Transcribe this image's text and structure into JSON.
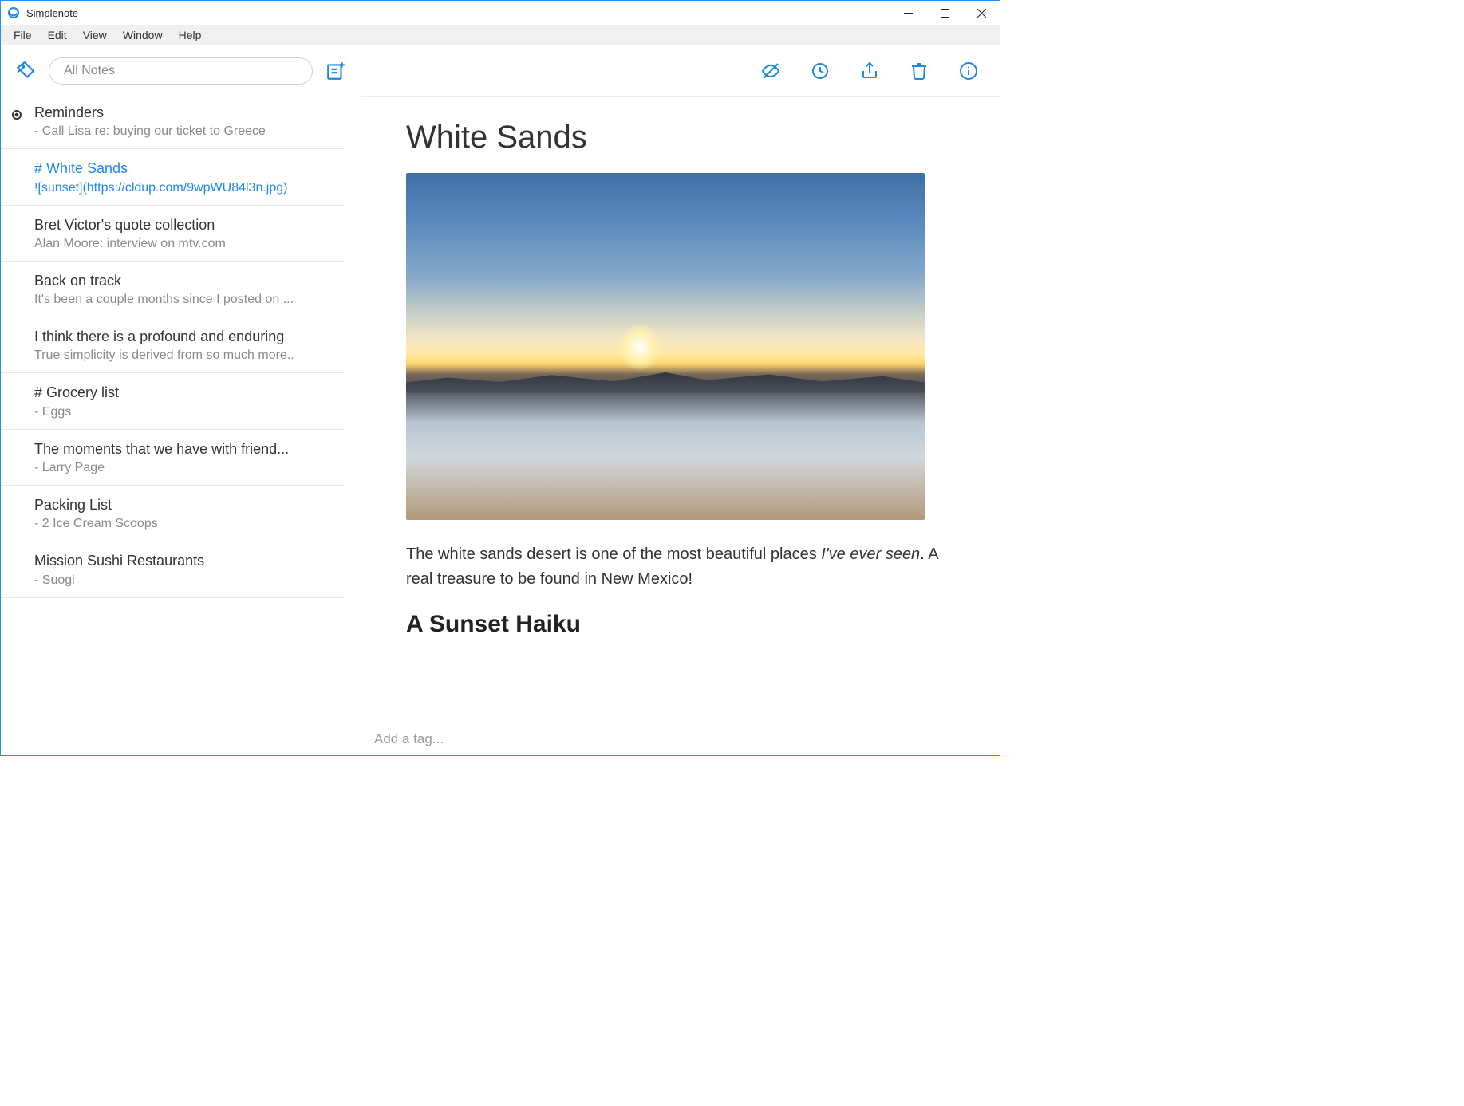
{
  "window": {
    "title": "Simplenote"
  },
  "menubar": {
    "items": [
      "File",
      "Edit",
      "View",
      "Window",
      "Help"
    ]
  },
  "sidebar": {
    "search_placeholder": "All Notes",
    "notes": [
      {
        "title": "Reminders",
        "preview": "- Call Lisa re: buying our ticket to Greece",
        "pinned": true,
        "selected": false
      },
      {
        "title": "# White Sands",
        "preview": "![sunset](https://cldup.com/9wpWU84l3n.jpg)",
        "pinned": false,
        "selected": true
      },
      {
        "title": "Bret Victor's quote collection",
        "preview": "Alan Moore: interview on mtv.com",
        "pinned": false,
        "selected": false
      },
      {
        "title": "Back on track",
        "preview": "It's been a couple months since I posted on ...",
        "pinned": false,
        "selected": false
      },
      {
        "title": "I think there is a profound and enduring",
        "preview": "True simplicity is derived from so much more..",
        "pinned": false,
        "selected": false
      },
      {
        "title": "# Grocery list",
        "preview": "- Eggs",
        "pinned": false,
        "selected": false
      },
      {
        "title": "The moments that we have with friend...",
        "preview": "- Larry Page",
        "pinned": false,
        "selected": false
      },
      {
        "title": "Packing List",
        "preview": "- 2 Ice Cream Scoops",
        "pinned": false,
        "selected": false
      },
      {
        "title": "Mission Sushi Restaurants",
        "preview": "- Suogi",
        "pinned": false,
        "selected": false
      }
    ]
  },
  "editor": {
    "title": "White Sands",
    "image_alt": "sunset",
    "paragraph_a": "The white sands desert is one of the most beautiful places ",
    "paragraph_em": "I've ever seen",
    "paragraph_b": ". A real treasure to be found in New Mexico!",
    "subheading": "A Sunset Haiku",
    "tag_placeholder": "Add a tag..."
  },
  "colors": {
    "accent": "#1e88e5"
  }
}
